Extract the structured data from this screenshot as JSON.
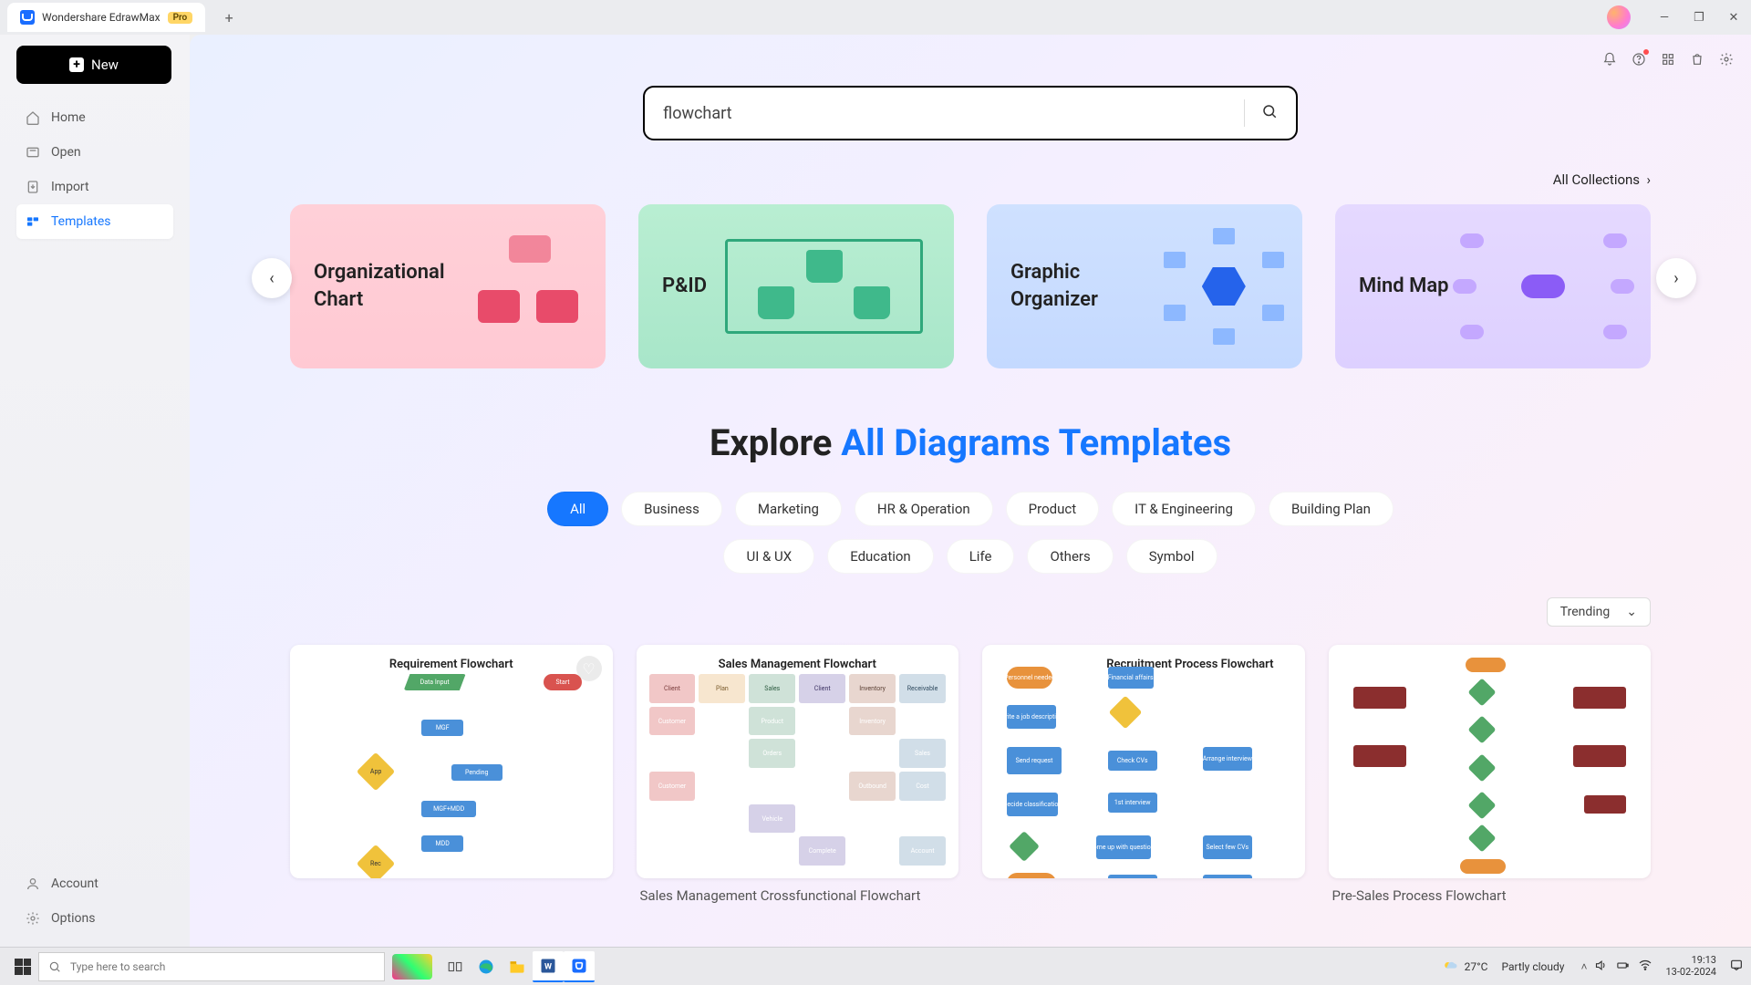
{
  "titlebar": {
    "app_name": "Wondershare EdrawMax",
    "badge": "Pro"
  },
  "sidebar": {
    "new_label": "New",
    "items": [
      {
        "label": "Home"
      },
      {
        "label": "Open"
      },
      {
        "label": "Import"
      },
      {
        "label": "Templates"
      }
    ],
    "bottom": [
      {
        "label": "Account"
      },
      {
        "label": "Options"
      }
    ]
  },
  "search": {
    "value": "flowchart"
  },
  "all_collections": "All Collections",
  "categories": [
    {
      "label": "Organizational Chart"
    },
    {
      "label": "P&ID"
    },
    {
      "label": "Graphic Organizer"
    },
    {
      "label": "Mind Map"
    }
  ],
  "explore": {
    "prefix": "Explore ",
    "highlight": "All Diagrams Templates"
  },
  "filters_row1": [
    "All",
    "Business",
    "Marketing",
    "HR & Operation",
    "Product",
    "IT & Engineering",
    "Building Plan"
  ],
  "filters_row2": [
    "UI & UX",
    "Education",
    "Life",
    "Others",
    "Symbol"
  ],
  "sort_label": "Trending",
  "templates": [
    {
      "title": "Requirement Flowchart",
      "caption": ""
    },
    {
      "title": "Sales Management Flowchart",
      "caption": "Sales Management Crossfunctional Flowchart"
    },
    {
      "title": "Recruitment Process Flowchart",
      "caption": ""
    },
    {
      "title": "",
      "caption": "Pre-Sales Process Flowchart"
    }
  ],
  "taskbar": {
    "search_placeholder": "Type here to search",
    "weather_temp": "27°C",
    "weather_desc": "Partly cloudy",
    "time": "19:13",
    "date": "13-02-2024"
  }
}
